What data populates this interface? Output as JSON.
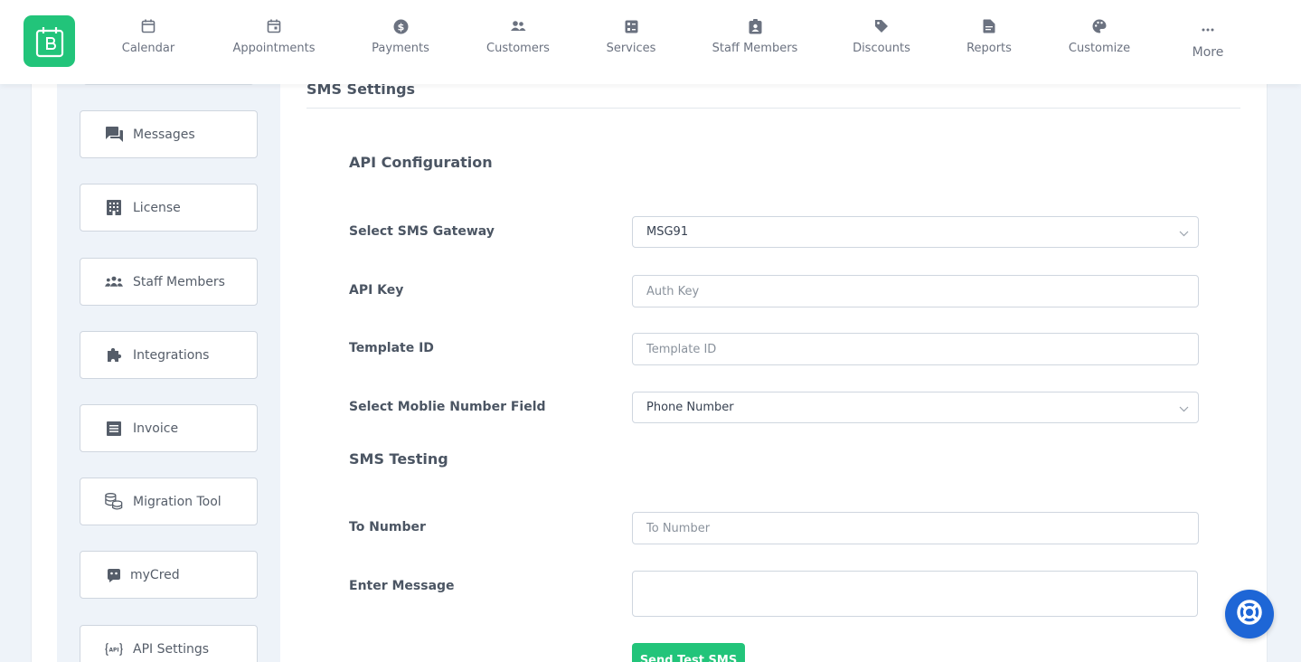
{
  "nav": {
    "items": [
      {
        "label": "Calendar",
        "icon": "calendar-icon"
      },
      {
        "label": "Appointments",
        "icon": "calendar-check-icon"
      },
      {
        "label": "Payments",
        "icon": "dollar-circle-icon"
      },
      {
        "label": "Customers",
        "icon": "people-icon"
      },
      {
        "label": "Services",
        "icon": "services-grid-icon"
      },
      {
        "label": "Staff Members",
        "icon": "badge-icon"
      },
      {
        "label": "Discounts",
        "icon": "tag-icon"
      },
      {
        "label": "Reports",
        "icon": "report-icon"
      },
      {
        "label": "Customize",
        "icon": "palette-icon"
      },
      {
        "label": "More",
        "icon": "more-dots-icon"
      }
    ]
  },
  "sidebar": {
    "items": [
      {
        "label": "Messages",
        "icon": "chat-icon"
      },
      {
        "label": "License",
        "icon": "building-icon"
      },
      {
        "label": "Staff Members",
        "icon": "group-icon"
      },
      {
        "label": "Integrations",
        "icon": "puzzle-icon"
      },
      {
        "label": "Invoice",
        "icon": "invoice-icon"
      },
      {
        "label": "Migration Tool",
        "icon": "database-icon"
      },
      {
        "label": "myCred",
        "icon": "mycred-icon"
      },
      {
        "label": "API Settings",
        "icon": "api-icon"
      }
    ]
  },
  "main": {
    "title": "SMS Settings",
    "api_section_title": "API Configuration",
    "gateway_label": "Select SMS Gateway",
    "gateway_value": "MSG91",
    "api_key_label": "API Key",
    "api_key_placeholder": "Auth Key",
    "template_label": "Template ID",
    "template_placeholder": "Template ID",
    "mobile_field_label": "Select Moblie Number Field",
    "mobile_field_value": "Phone Number",
    "testing_section_title": "SMS Testing",
    "to_number_label": "To Number",
    "to_number_placeholder": "To Number",
    "message_label": "Enter Message",
    "send_button": "Send Test SMS"
  },
  "colors": {
    "accent": "#22c47a",
    "help": "#1e66d6",
    "background": "#eef3f9"
  }
}
